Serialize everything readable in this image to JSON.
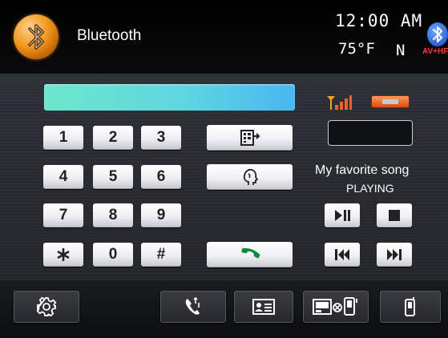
{
  "header": {
    "app_title": "Bluetooth",
    "time": "12:00 AM",
    "temperature": "75°F",
    "heading": "N",
    "badge_text": "AV+HF",
    "logo_icon": "bluetooth-logo-icon"
  },
  "dialer": {
    "display_value": "",
    "keys": [
      "1",
      "2",
      "3",
      "4",
      "5",
      "6",
      "7",
      "8",
      "9",
      "*",
      "0",
      "#"
    ],
    "actions": [
      "contacts-transfer-icon",
      "voice-dial-icon",
      "call-icon"
    ]
  },
  "status": {
    "signal_icon": "signal-strength-icon",
    "battery_icon": "battery-icon",
    "device_name": ""
  },
  "music": {
    "song_title": "My favorite song",
    "song_status": "PLAYING",
    "controls": [
      "play-pause-icon",
      "stop-icon",
      "previous-track-icon",
      "next-track-icon"
    ]
  },
  "bottom_nav": [
    "settings-icon",
    "call-log-icon",
    "contact-card-icon",
    "pair-device-icon",
    "phone-icon"
  ],
  "colors": {
    "display_gradient_start": "#6ee6cc",
    "display_gradient_end": "#4ab6f0",
    "call_green": "#0a8a3a",
    "battery_orange": "#e8642a",
    "signal_orange": "#f0a020"
  }
}
